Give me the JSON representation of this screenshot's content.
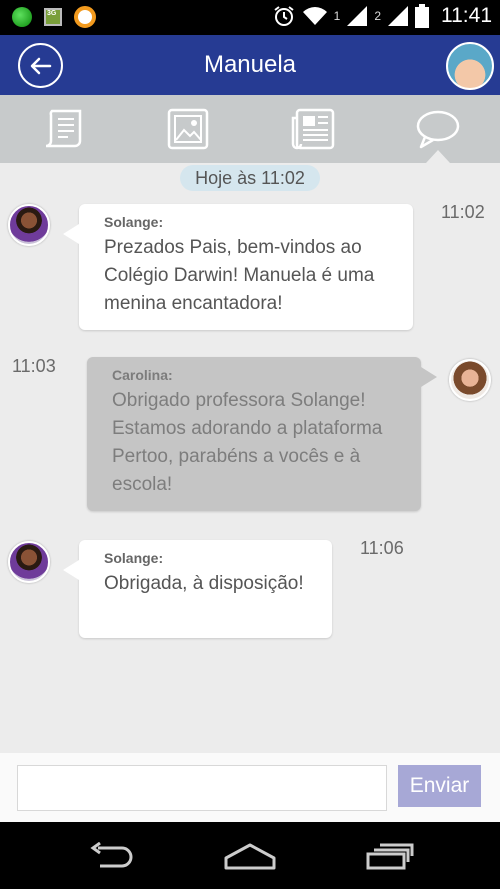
{
  "status_bar": {
    "icons": [
      "green-dot-icon",
      "3g-image-icon",
      "orange-ring-icon",
      "alarm-icon",
      "wifi-icon",
      "signal-icon",
      "signal-icon",
      "battery-icon"
    ],
    "sim1": "1",
    "sim2": "2",
    "time": "11:41",
    "app_badge": "3G"
  },
  "header": {
    "title": "Manuela",
    "back_icon": "arrow-left-icon",
    "avatar": "child-avatar"
  },
  "tabs": [
    {
      "icon": "scroll-icon",
      "active": false
    },
    {
      "icon": "image-icon",
      "active": false
    },
    {
      "icon": "newspaper-icon",
      "active": false
    },
    {
      "icon": "speech-bubble-icon",
      "active": true
    }
  ],
  "chat": {
    "date_label": "Hoje às 11:02",
    "messages": [
      {
        "sender": "Solange:",
        "text": "Prezados Pais, bem-vindos ao Colégio Darwin! Manuela é uma menina encantadora!",
        "time": "11:02",
        "side": "left"
      },
      {
        "sender": "Carolina:",
        "text": "Obrigado professora Solange! Estamos adorando a plataforma Pertoo, parabéns a vocês e à escola!",
        "time": "11:03",
        "side": "right"
      },
      {
        "sender": "Solange:",
        "text": "Obrigada, à disposição!",
        "time": "11:06",
        "side": "left"
      }
    ]
  },
  "composer": {
    "input_value": "",
    "send_label": "Enviar"
  },
  "nav": {
    "icons": [
      "back-icon",
      "home-icon",
      "recents-icon"
    ]
  },
  "colors": {
    "header": "#263b93",
    "tab_bar": "#c7cacb",
    "chat_bg": "#ececec",
    "send_button": "#a7a8d6"
  }
}
